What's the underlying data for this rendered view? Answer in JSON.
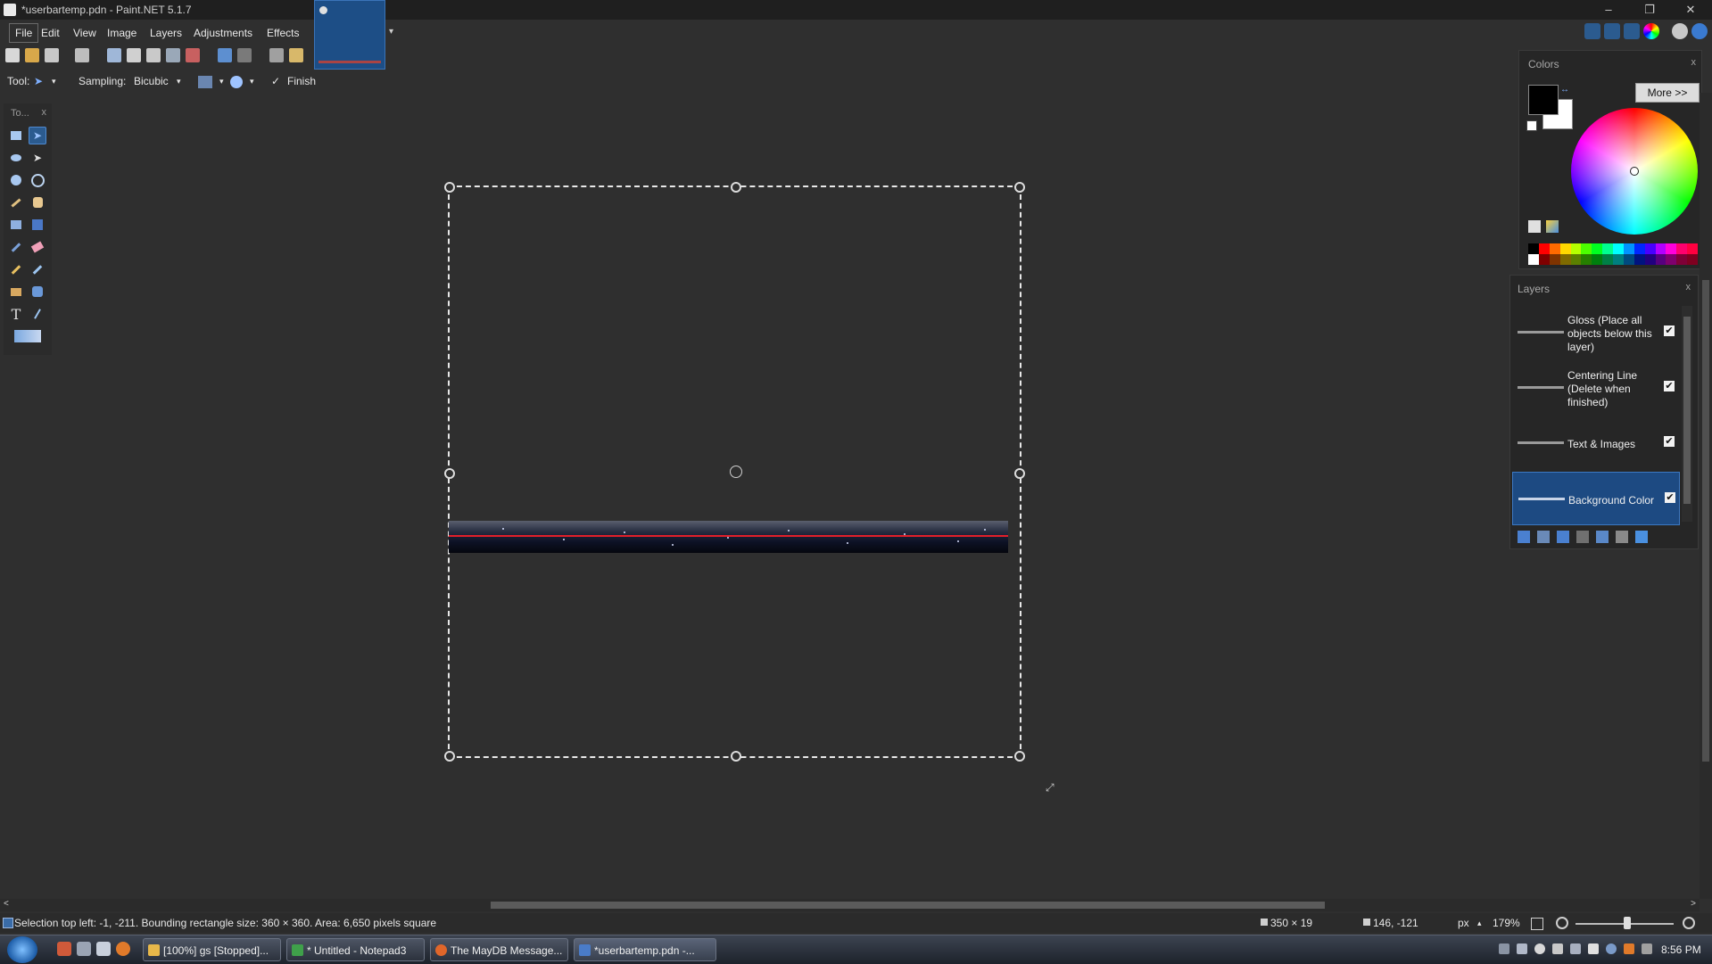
{
  "window": {
    "title": "*userbartemp.pdn - Paint.NET 5.1.7",
    "minimize": "–",
    "restore": "❐",
    "close": "✕"
  },
  "menu": {
    "items": [
      "File",
      "Edit",
      "View",
      "Image",
      "Layers",
      "Adjustments",
      "Effects"
    ]
  },
  "tool_options": {
    "tool_label": "Tool:",
    "sampling_label": "Sampling:",
    "sampling_value": "Bicubic",
    "finish_label": "Finish"
  },
  "tools_panel": {
    "header": "To...",
    "close": "x"
  },
  "colors_panel": {
    "header": "Colors",
    "close": "x",
    "more_button": "More >>",
    "primary_color": "#000000",
    "secondary_color": "#ffffff",
    "palette": [
      "#000000",
      "#ff0000",
      "#ff6a00",
      "#ffd800",
      "#b6ff00",
      "#4cff00",
      "#00ff21",
      "#00ff90",
      "#00ffff",
      "#0094ff",
      "#0026ff",
      "#4800ff",
      "#b200ff",
      "#ff00dc",
      "#ff006e",
      "#ff0040",
      "#ffffff",
      "#7f0000",
      "#7f3300",
      "#7f6a00",
      "#5b7f00",
      "#267f00",
      "#007f0e",
      "#007f46",
      "#007f7f",
      "#004a7f",
      "#00137f",
      "#21007f",
      "#57007f",
      "#7f006e",
      "#7f0037",
      "#7f0020"
    ]
  },
  "layers_panel": {
    "header": "Layers",
    "close": "x",
    "layers": [
      {
        "name": "Gloss (Place all objects below this layer)",
        "visible": true,
        "selected": false
      },
      {
        "name": "Centering Line (Delete when finished)",
        "visible": true,
        "selected": false
      },
      {
        "name": "Text & Images",
        "visible": true,
        "selected": false
      },
      {
        "name": "Background Color",
        "visible": true,
        "selected": true
      }
    ],
    "check": "✔"
  },
  "status": {
    "selection_text": "Selection top left: -1, -211. Bounding rectangle size: 360 × 360. Area: 6,650 pixels square",
    "image_size": "350 × 19",
    "cursor_pos": "146, -121",
    "units": "px",
    "zoom": "179%"
  },
  "taskbar": {
    "buttons": [
      {
        "label": "[100%] gs [Stopped]...",
        "color": "#e8b84a"
      },
      {
        "label": "* Untitled - Notepad3",
        "color": "#3fa04a"
      },
      {
        "label": "The MayDB Message...",
        "color": "#e0662a"
      },
      {
        "label": "*userbartemp.pdn -...",
        "color": "#4a7cc8"
      }
    ],
    "clock": "8:56 PM"
  },
  "icons": {
    "move_handle": "⊕",
    "resize_handle": "⤢",
    "dropdown": "▾",
    "check_finish": "✓"
  }
}
